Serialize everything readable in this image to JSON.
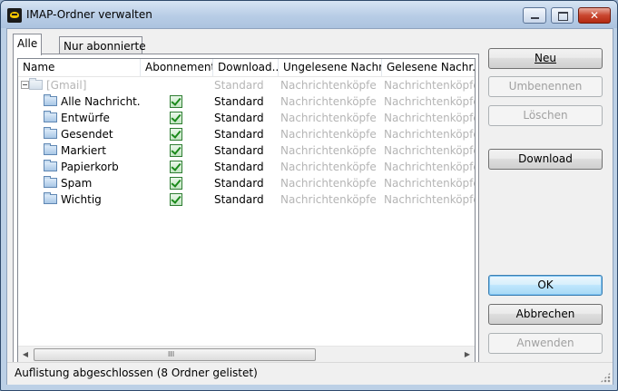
{
  "window": {
    "title": "IMAP-Ordner verwalten",
    "close_glyph": "✕"
  },
  "tabs": [
    {
      "label": "Alle",
      "active": true
    },
    {
      "label": "Nur abonnierte",
      "active": false
    }
  ],
  "columns": [
    "Name",
    "Abonnement",
    "Download...",
    "Ungelesene Nachr...",
    "Gelesene Nachr..."
  ],
  "root_folder": {
    "name": "[Gmail]",
    "download": "Standard",
    "unread": "Nachrichtenköpfe",
    "read": "Nachrichtenköpfe"
  },
  "folders": [
    {
      "name": "Alle Nachricht...",
      "download": "Standard",
      "unread": "Nachrichtenköpfe",
      "read": "Nachrichtenköpfe",
      "subscribed": true
    },
    {
      "name": "Entwürfe",
      "download": "Standard",
      "unread": "Nachrichtenköpfe",
      "read": "Nachrichtenköpfe",
      "subscribed": true
    },
    {
      "name": "Gesendet",
      "download": "Standard",
      "unread": "Nachrichtenköpfe",
      "read": "Nachrichtenköpfe",
      "subscribed": true
    },
    {
      "name": "Markiert",
      "download": "Standard",
      "unread": "Nachrichtenköpfe",
      "read": "Nachrichtenköpfe",
      "subscribed": true
    },
    {
      "name": "Papierkorb",
      "download": "Standard",
      "unread": "Nachrichtenköpfe",
      "read": "Nachrichtenköpfe",
      "subscribed": true
    },
    {
      "name": "Spam",
      "download": "Standard",
      "unread": "Nachrichtenköpfe",
      "read": "Nachrichtenköpfe",
      "subscribed": true
    },
    {
      "name": "Wichtig",
      "download": "Standard",
      "unread": "Nachrichtenköpfe",
      "read": "Nachrichtenköpfe",
      "subscribed": true
    }
  ],
  "buttons": {
    "neu": {
      "label": "Neu",
      "enabled": true
    },
    "umbenennen": {
      "label": "Umbenennen",
      "enabled": false
    },
    "loeschen": {
      "label": "Löschen",
      "enabled": false
    },
    "download": {
      "label": "Download",
      "enabled": true
    },
    "ok": {
      "label": "OK",
      "enabled": true
    },
    "abbrechen": {
      "label": "Abbrechen",
      "enabled": true
    },
    "anwenden": {
      "label": "Anwenden",
      "enabled": false
    }
  },
  "scrollbar": {
    "grip": "III"
  },
  "status": "Auflistung abgeschlossen (8 Ordner gelistet)",
  "colors": {
    "accent": "#3c7fb1",
    "disabled_text": "#b5b5b5",
    "check_green": "#1b8a1b"
  }
}
